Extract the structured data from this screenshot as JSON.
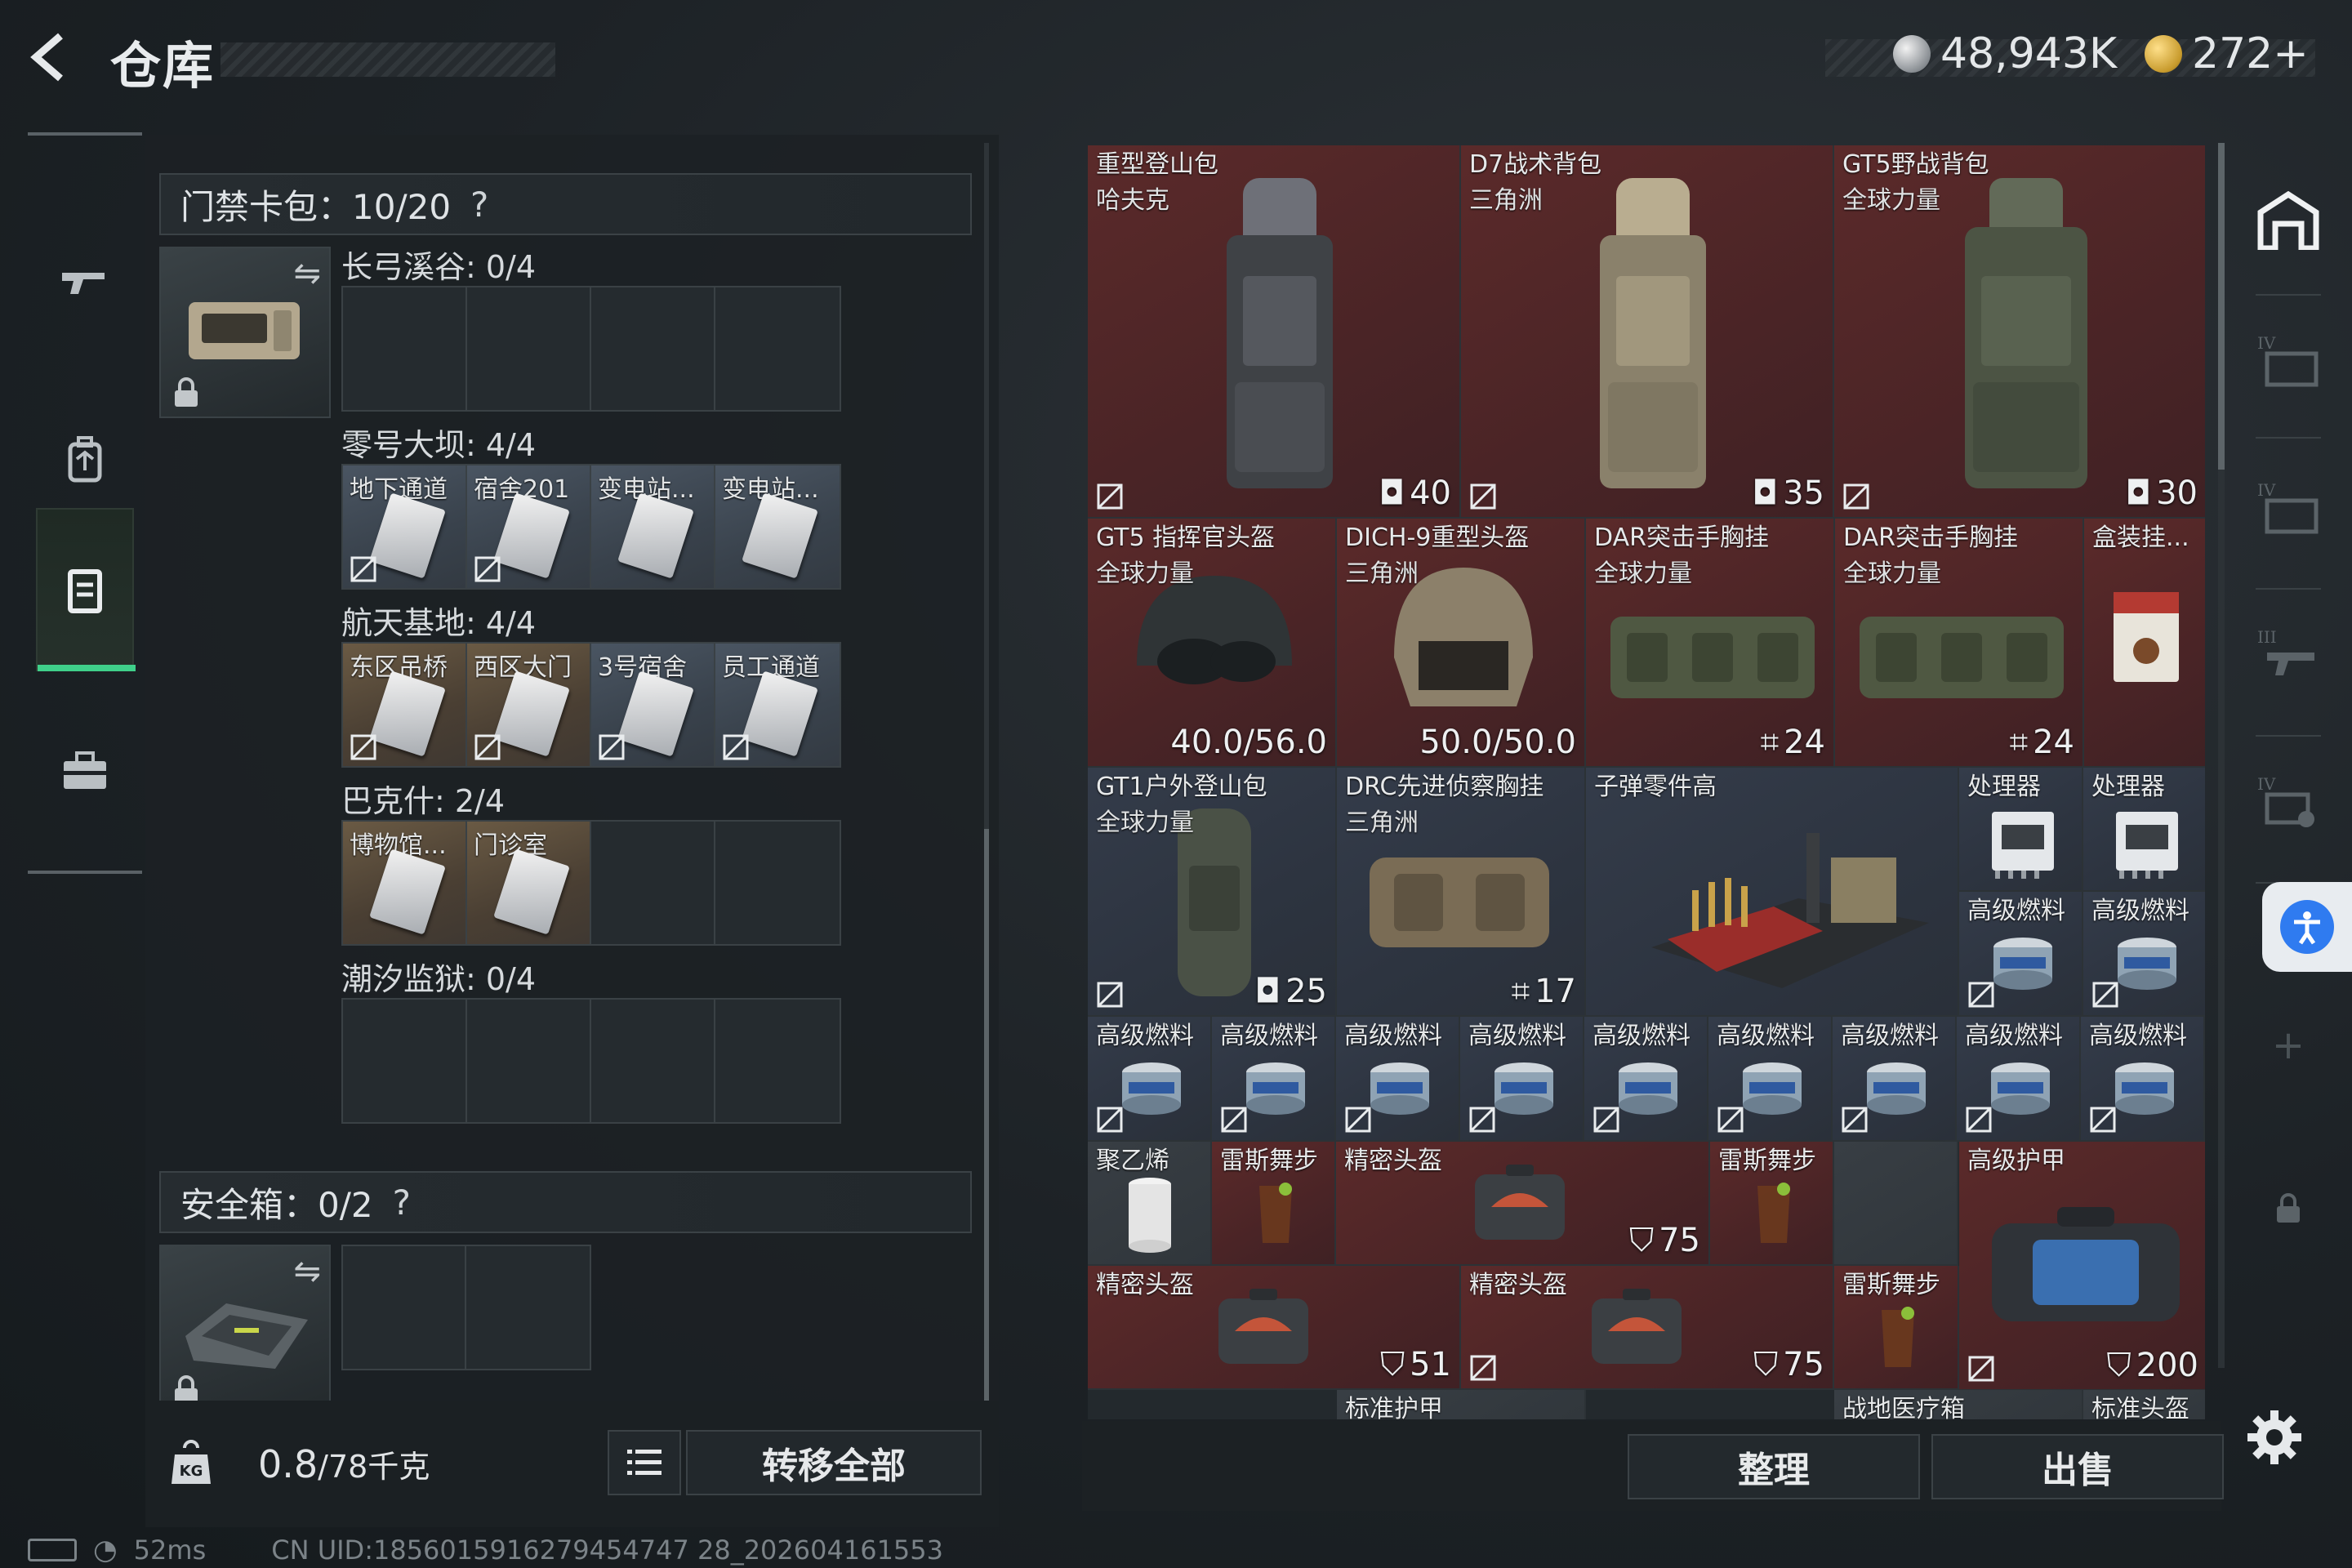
{
  "header": {
    "title": "仓库",
    "currency_silver": "48,943K",
    "currency_gold": "272+"
  },
  "left_rail": {
    "items": [
      {
        "name": "weapon-tab"
      },
      {
        "name": "backpack-tab"
      },
      {
        "name": "container-tab"
      },
      {
        "name": "toolbox-tab"
      }
    ]
  },
  "keycard_pack": {
    "header": "门禁卡包：10/20",
    "help": "?",
    "groups": [
      {
        "label": "长弓溪谷: 0/4",
        "slots": [
          "",
          "",
          "",
          ""
        ]
      },
      {
        "label": "零号大坝: 4/4",
        "slots": [
          "地下通道",
          "宿舍201",
          "变电站...",
          "变电站..."
        ]
      },
      {
        "label": "航天基地: 4/4",
        "slots": [
          "东区吊桥",
          "西区大门",
          "3号宿舍",
          "员工通道"
        ]
      },
      {
        "label": "巴克什: 2/4",
        "slots": [
          "博物馆...",
          "门诊室",
          "",
          ""
        ]
      },
      {
        "label": "潮汐监狱: 0/4",
        "slots": [
          "",
          "",
          "",
          ""
        ]
      }
    ]
  },
  "safe_box": {
    "header": "安全箱：0/2",
    "help": "?"
  },
  "weight": {
    "value": "0.8",
    "capacity": "/78千克"
  },
  "buttons": {
    "transfer_all": "转移全部",
    "organize": "整理",
    "sell": "出售"
  },
  "status_bar": {
    "ping": "52ms",
    "uid": "CN UID:1856015916279454747 28_202604161553"
  },
  "warehouse_items": [
    {
      "name": "重型登山包",
      "sub": "哈夫克",
      "stat": "40",
      "stat_icon": "capacity-icon"
    },
    {
      "name": "D7战术背包",
      "sub": "三角洲",
      "stat": "35",
      "stat_icon": "capacity-icon"
    },
    {
      "name": "GT5野战背包",
      "sub": "全球力量",
      "stat": "30",
      "stat_icon": "capacity-icon"
    },
    {
      "name": "GT5 指挥官头盔",
      "sub": "全球力量",
      "stat": "40.0/56.0"
    },
    {
      "name": "DICH-9重型头盔",
      "sub": "三角洲",
      "stat": "50.0/50.0"
    },
    {
      "name": "DAR突击手胸挂",
      "sub": "全球力量",
      "stat": "24",
      "stat_icon": "rig-icon"
    },
    {
      "name": "DAR突击手胸挂",
      "sub": "全球力量",
      "stat": "24",
      "stat_icon": "rig-icon"
    },
    {
      "name": "盒装挂..."
    },
    {
      "name": "GT1户外登山包",
      "sub": "全球力量",
      "stat": "25",
      "stat_icon": "capacity-icon"
    },
    {
      "name": "DRC先进侦察胸挂",
      "sub": "三角洲",
      "stat": "17",
      "stat_icon": "rig-icon"
    },
    {
      "name": "子弹零件高"
    },
    {
      "name": "处理器"
    },
    {
      "name": "处理器"
    },
    {
      "name": "高级燃料"
    },
    {
      "name": "高级燃料"
    },
    {
      "name": "聚乙烯"
    },
    {
      "name": "雷斯舞步"
    },
    {
      "name": "精密头盔",
      "stat": "75",
      "stat_icon": "armor-icon"
    },
    {
      "name": "雷斯舞步"
    },
    {
      "name": "高级护甲",
      "stat": "200",
      "stat_icon": "armor-icon"
    },
    {
      "name": "精密头盔",
      "stat": "51",
      "stat_icon": "armor-icon"
    },
    {
      "name": "精密头盔",
      "stat": "75",
      "stat_icon": "armor-icon"
    },
    {
      "name": "雷斯舞步"
    },
    {
      "name": "标准护甲"
    },
    {
      "name": "战地医疗箱"
    },
    {
      "name": "标准头盔"
    }
  ],
  "fuel_row_label": "高级燃料",
  "colors": {
    "accent_green": "#3fd08a",
    "rarity_red": "#5b2a2a",
    "rarity_blue": "#343c4a",
    "accessibility_blue": "#2f7bf0"
  }
}
